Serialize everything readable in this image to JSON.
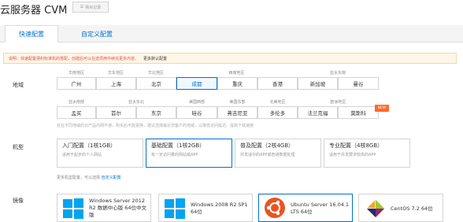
{
  "header": {
    "title": "云服务器 CVM",
    "purchase_button": "购买记录"
  },
  "tabs": [
    {
      "label": "快速配置",
      "active": true
    },
    {
      "label": "自定义配置",
      "active": false
    }
  ],
  "notice": {
    "text": "说明：快速配置便利标准机的搭配，创建后可以在选项用中续充更多内容。",
    "link": "更多默认配置"
  },
  "region": {
    "label": "地域",
    "row1_groups": [
      "华南地区",
      "华东地区",
      "华北地区",
      "西南地区",
      "亚太东南"
    ],
    "row1": [
      "广州",
      "上海",
      "北京",
      "成都",
      "重庆",
      "香港",
      "新加坡",
      "曼谷"
    ],
    "row2_groups": [
      "亚太南部",
      "亚太东北",
      "美国西部",
      "美国东部",
      "北美地区",
      "欧洲地区"
    ],
    "row2": [
      "孟买",
      "首尔",
      "东京",
      "硅谷",
      "弗吉尼亚",
      "多伦多",
      "法兰克福",
      "莫斯科"
    ],
    "selected": "成都",
    "new_badge": "NEW",
    "hint": "处在不同地域的云产品内网不通，购买后不能更换，建议选择最近您客户的地域，以降低访问延迟、提高下载速度"
  },
  "model": {
    "label": "机型",
    "options": [
      {
        "title": "入门配置（1核1GB）",
        "desc": "适用于起步的个人网站"
      },
      {
        "title": "基础配置（1核2GB）",
        "desc": "有一定访问量的网站或APP"
      },
      {
        "title": "普及配置（2核4GB）",
        "desc": "并发适中的APP或普通数据处理"
      },
      {
        "title": "专业配置（4核8GB）",
        "desc": "适用于并发要求较高的APP"
      }
    ],
    "selected_index": 1,
    "more_text": "更多机型配置，可以选择",
    "more_link": "自定义配置"
  },
  "image": {
    "label": "镜像",
    "options": [
      {
        "name": "Windows Server 2012 R2 数据中心版 64位中文版",
        "icon": "windows-icon"
      },
      {
        "name": "Windows 2008 R2 SP1 64位",
        "icon": "windows-icon"
      },
      {
        "name": "Ubuntu Server 16.04.1 LTS 64位",
        "icon": "ubuntu-icon"
      },
      {
        "name": "CentOS 7.2 64位",
        "icon": "centos-icon"
      }
    ],
    "selected_index": 2
  },
  "colors": {
    "accent": "#0071ce",
    "warning_bg": "#fff6e8",
    "warning_text": "#e1504a",
    "badge": "#ff6a2b",
    "ubuntu": "#e95420"
  }
}
